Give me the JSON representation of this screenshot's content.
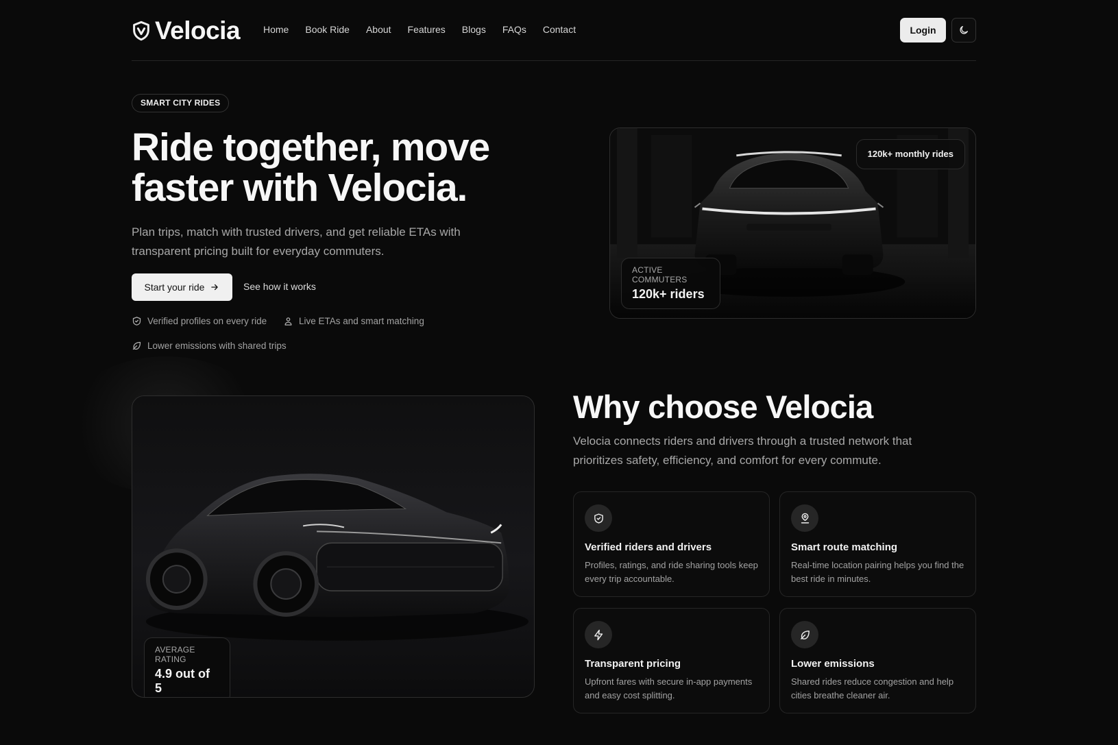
{
  "nav": {
    "brand": "Velocia",
    "items": [
      {
        "label": "Home"
      },
      {
        "label": "Book Ride"
      },
      {
        "label": "About"
      },
      {
        "label": "Features"
      },
      {
        "label": "Blogs"
      },
      {
        "label": "FAQs"
      },
      {
        "label": "Contact"
      }
    ],
    "login_label": "Login"
  },
  "hero": {
    "badge": "SMART CITY RIDES",
    "title": "Ride together, move faster with Velocia.",
    "subtitle": "Plan trips, match with trusted drivers, and get reliable ETAs with transparent pricing built for everyday commuters.",
    "primary_cta": "Start your ride",
    "secondary_cta": "See how it works",
    "features": [
      {
        "icon": "shield-check-icon",
        "label": "Verified profiles on every ride"
      },
      {
        "icon": "user-pin-icon",
        "label": "Live ETAs and smart matching"
      },
      {
        "icon": "leaf-icon",
        "label": "Lower emissions with shared trips"
      }
    ],
    "image_pill": "120k+ monthly rides",
    "image_stat": {
      "label": "ACTIVE COMMUTERS",
      "value": "120k+ riders"
    }
  },
  "why": {
    "title": "Why choose Velocia",
    "subtitle": "Velocia connects riders and drivers through a trusted network that prioritizes safety, efficiency, and comfort for every commute.",
    "image_stat": {
      "label": "AVERAGE RATING",
      "value": "4.9 out of 5"
    },
    "cards": [
      {
        "icon": "shield-check-icon",
        "title": "Verified riders and drivers",
        "desc": "Profiles, ratings, and ride sharing tools keep every trip accountable."
      },
      {
        "icon": "user-pin-icon",
        "title": "Smart route matching",
        "desc": "Real-time location pairing helps you find the best ride in minutes."
      },
      {
        "icon": "lightning-icon",
        "title": "Transparent pricing",
        "desc": "Upfront fares with secure in-app payments and easy cost splitting."
      },
      {
        "icon": "leaf-icon",
        "title": "Lower emissions",
        "desc": "Shared rides reduce congestion and help cities breathe cleaner air."
      }
    ]
  }
}
